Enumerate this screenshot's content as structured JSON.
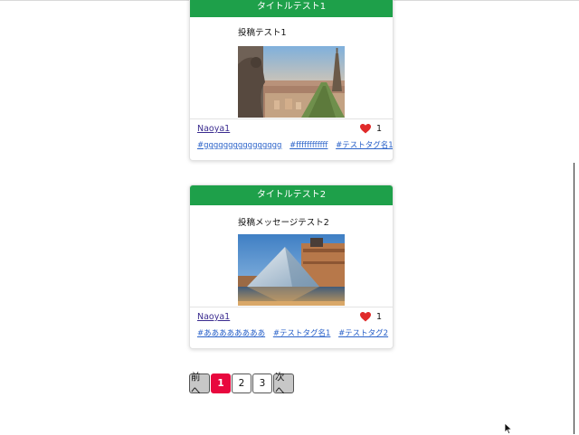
{
  "posts": [
    {
      "title": "タイトルテスト1",
      "message": "投稿テスト1",
      "image_icon": "paris-city-photo",
      "author": "Naoya1",
      "likes": "1",
      "tags": [
        "#gggggggggggggggg",
        "#ffffffffffff",
        "#テストタグ名1"
      ]
    },
    {
      "title": "タイトルテスト2",
      "message": "投稿メッセージテスト2",
      "image_icon": "louvre-pyramid-photo",
      "author": "Naoya1",
      "likes": "1",
      "tags": [
        "#ああああああああ",
        "#テストタグ名1",
        "#テストタグ2"
      ]
    }
  ],
  "pagination": {
    "prev_label": "前へ",
    "pages": [
      "1",
      "2",
      "3"
    ],
    "current": "1",
    "next_label": "次へ"
  },
  "colors": {
    "header_green": "#1ea04a",
    "active_page": "#e8083e",
    "heart": "#e02a2a",
    "tag_link": "#2a62c9",
    "author_link": "#3a2b8f"
  }
}
